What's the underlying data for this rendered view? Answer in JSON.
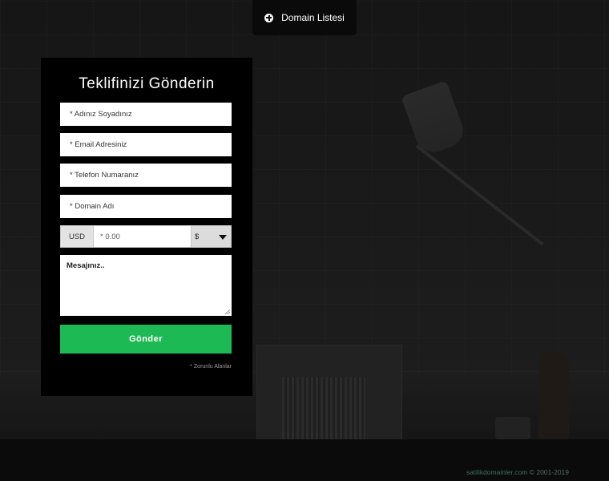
{
  "top_tab": {
    "label": "Domain Listesi",
    "icon": "plus-circle-icon"
  },
  "form": {
    "title": "Teklifinizi Gönderin",
    "name_placeholder": "* Adınız Soyadınız",
    "email_placeholder": "* Email Adresiniz",
    "phone_placeholder": "* Telefon Numaranız",
    "domain_placeholder": "* Domain Adı",
    "currency_code": "USD",
    "price_placeholder": "* 0.00",
    "currency_symbol": "$",
    "message_placeholder": "Mesajınız..",
    "submit_label": "Gönder",
    "required_note": "* Zorunlu Alanlar"
  },
  "footer": {
    "brand": "satilikdomainler.com",
    "copyright": " © 2001-2019"
  },
  "colors": {
    "accent": "#1db954",
    "panel": "#000000",
    "background": "#141414"
  }
}
